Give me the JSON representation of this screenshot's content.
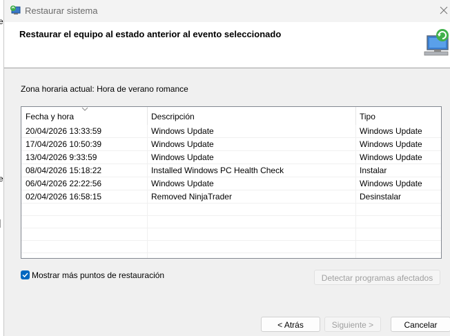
{
  "window": {
    "title": "Restaurar sistema"
  },
  "header": {
    "title": "Restaurar el equipo al estado anterior al evento seleccionado"
  },
  "timezone": "Zona horaria actual: Hora de verano romance",
  "table": {
    "columns": [
      "Fecha y hora",
      "Descripción",
      "Tipo"
    ],
    "rows": [
      [
        "20/04/2026 13:33:59",
        "Windows Update",
        "Windows Update"
      ],
      [
        "17/04/2026 10:50:39",
        "Windows Update",
        "Windows Update"
      ],
      [
        "13/04/2026 9:33:59",
        "Windows Update",
        "Windows Update"
      ],
      [
        "08/04/2026 15:18:22",
        "Installed Windows PC Health Check",
        "Instalar"
      ],
      [
        "06/04/2026 22:22:56",
        "Windows Update",
        "Windows Update"
      ],
      [
        "02/04/2026 16:58:15",
        "Removed NinjaTrader",
        "Desinstalar"
      ]
    ]
  },
  "show_more": {
    "label": "Mostrar más puntos de restauración",
    "checked": true
  },
  "buttons": {
    "detect": "Detectar programas afectados",
    "back": "< Atrás",
    "next": "Siguiente >",
    "cancel": "Cancelar"
  },
  "colors": {
    "accent": "#0067c0",
    "disabled_text": "#a0a0a0"
  },
  "icons": {
    "title": "system-restore-icon",
    "header": "computer-restore-icon",
    "close": "close-icon",
    "sort": "sort-chevron-icon"
  }
}
